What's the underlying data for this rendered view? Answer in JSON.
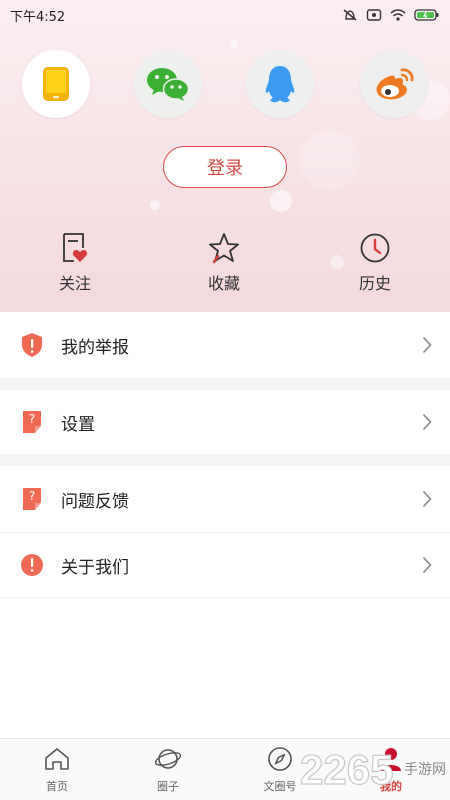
{
  "status_bar": {
    "time": "下午4:52"
  },
  "social_login": [
    {
      "name": "phone",
      "icon": "phone-icon",
      "color": "#f5b400"
    },
    {
      "name": "wechat",
      "icon": "wechat-icon",
      "color": "#3cb034"
    },
    {
      "name": "qq",
      "icon": "qq-icon",
      "color": "#3b9cf2"
    },
    {
      "name": "weibo",
      "icon": "weibo-icon",
      "color": "#f07a22"
    }
  ],
  "login_button": {
    "label": "登录"
  },
  "quick_actions": [
    {
      "label": "关注",
      "icon": "follow-heart-icon"
    },
    {
      "label": "收藏",
      "icon": "star-icon"
    },
    {
      "label": "历史",
      "icon": "clock-icon"
    }
  ],
  "menu": [
    {
      "label": "我的举报",
      "icon": "report-shield-icon"
    },
    {
      "label": "设置",
      "icon": "settings-edit-icon"
    },
    {
      "label": "问题反馈",
      "icon": "feedback-edit-icon"
    },
    {
      "label": "关于我们",
      "icon": "info-icon"
    }
  ],
  "bottom_nav": [
    {
      "label": "首页",
      "icon": "home-icon",
      "active": false
    },
    {
      "label": "圈子",
      "icon": "planet-icon",
      "active": false
    },
    {
      "label": "文圈号",
      "icon": "compass-icon",
      "active": false
    },
    {
      "label": "我的",
      "icon": "profile-icon",
      "active": true
    }
  ],
  "watermark": {
    "number": "2265",
    "suffix": "手游网"
  },
  "colors": {
    "accent": "#d9453f",
    "menu_icon": "#ee6a55",
    "header_pink": "#f7e1e5"
  }
}
